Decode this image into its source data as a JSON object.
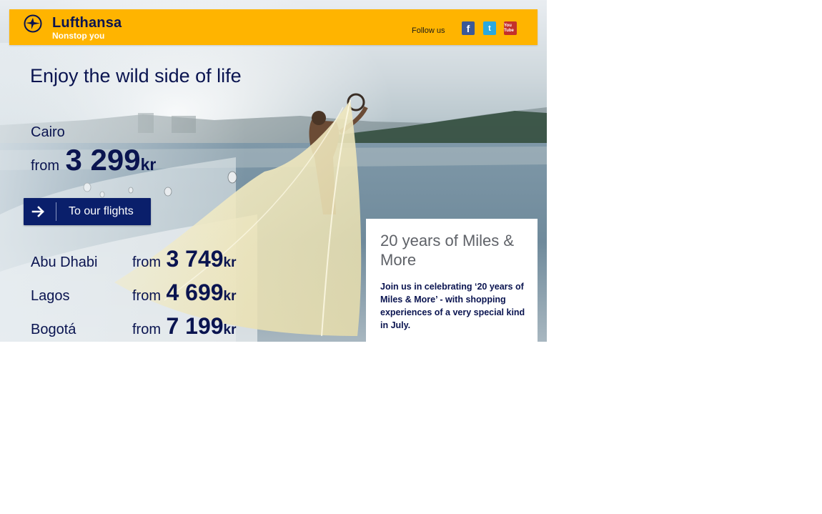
{
  "brand": {
    "name": "Lufthansa",
    "tagline": "Nonstop you",
    "logo_icon": "crane-logo-icon",
    "color_primary": "#ffb400",
    "color_navy": "#0a1450"
  },
  "social": {
    "label": "Follow us",
    "items": [
      {
        "name": "facebook-icon",
        "glyph": "f"
      },
      {
        "name": "twitter-icon",
        "glyph": "t"
      },
      {
        "name": "youtube-icon",
        "glyph": "You Tube"
      }
    ]
  },
  "hero": {
    "headline": "Enjoy the wild side of life",
    "featured": {
      "city": "Cairo",
      "from": "from",
      "amount": "3 299",
      "currency": "kr"
    },
    "cta": {
      "label": "To our flights",
      "icon": "arrow-right-icon"
    }
  },
  "routes": [
    {
      "city": "Abu Dhabi",
      "from": "from",
      "amount": "3 749",
      "currency": "kr"
    },
    {
      "city": "Lagos",
      "from": "from",
      "amount": "4 699",
      "currency": "kr"
    },
    {
      "city": "Bogotá",
      "from": "from",
      "amount": "7 199",
      "currency": "kr"
    }
  ],
  "promo": {
    "title": "20 years of Miles & More",
    "body": "Join us in celebrating ‘20 years of Miles & More’ - with shopping experiences of a very special kind in July."
  }
}
